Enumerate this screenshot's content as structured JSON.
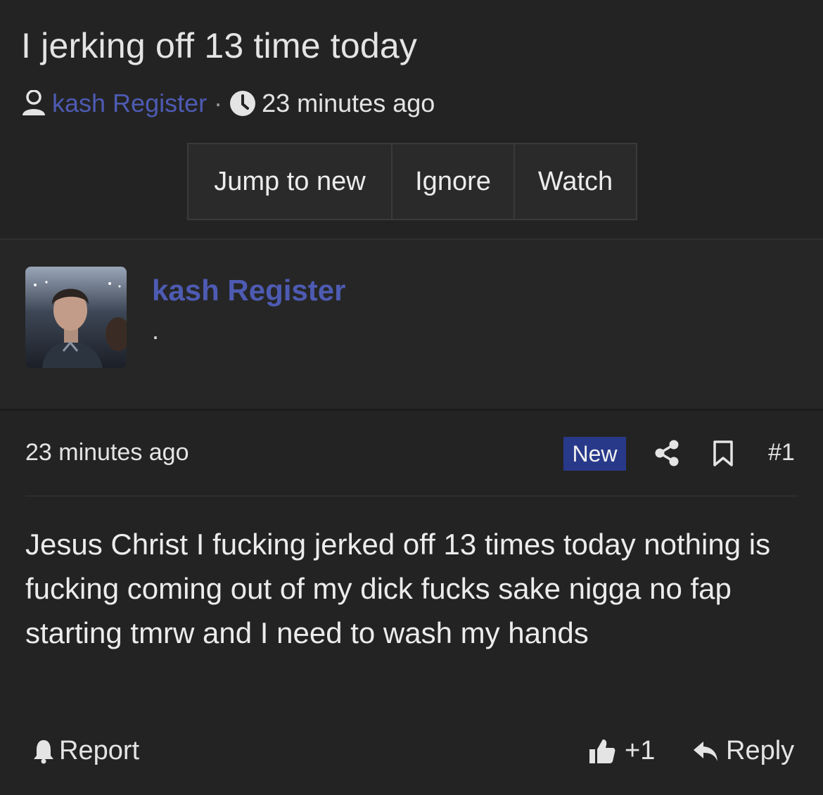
{
  "thread": {
    "title": "I jerking off 13 time today",
    "author": "kash Register",
    "separator": "·",
    "time": "23 minutes ago"
  },
  "buttons": {
    "jump_to_new": "Jump to new",
    "ignore": "Ignore",
    "watch": "Watch"
  },
  "user": {
    "name": "kash Register",
    "title": "."
  },
  "post": {
    "date": "23 minutes ago",
    "badge": "New",
    "number": "#1",
    "body": "Jesus Christ I fucking jerked off 13 times today nothing is fucking coming out of my dick fucks sake nigga no fap starting tmrw and I need to wash my hands",
    "report": "Report",
    "like_count": "+1",
    "reply": "Reply"
  },
  "colors": {
    "background": "#232323",
    "link": "#4e5bb3",
    "badge": "#28398a"
  },
  "icons": [
    "user-icon",
    "clock-icon",
    "share-icon",
    "bookmark-icon",
    "bell-icon",
    "thumbs-up-icon",
    "reply-icon"
  ]
}
